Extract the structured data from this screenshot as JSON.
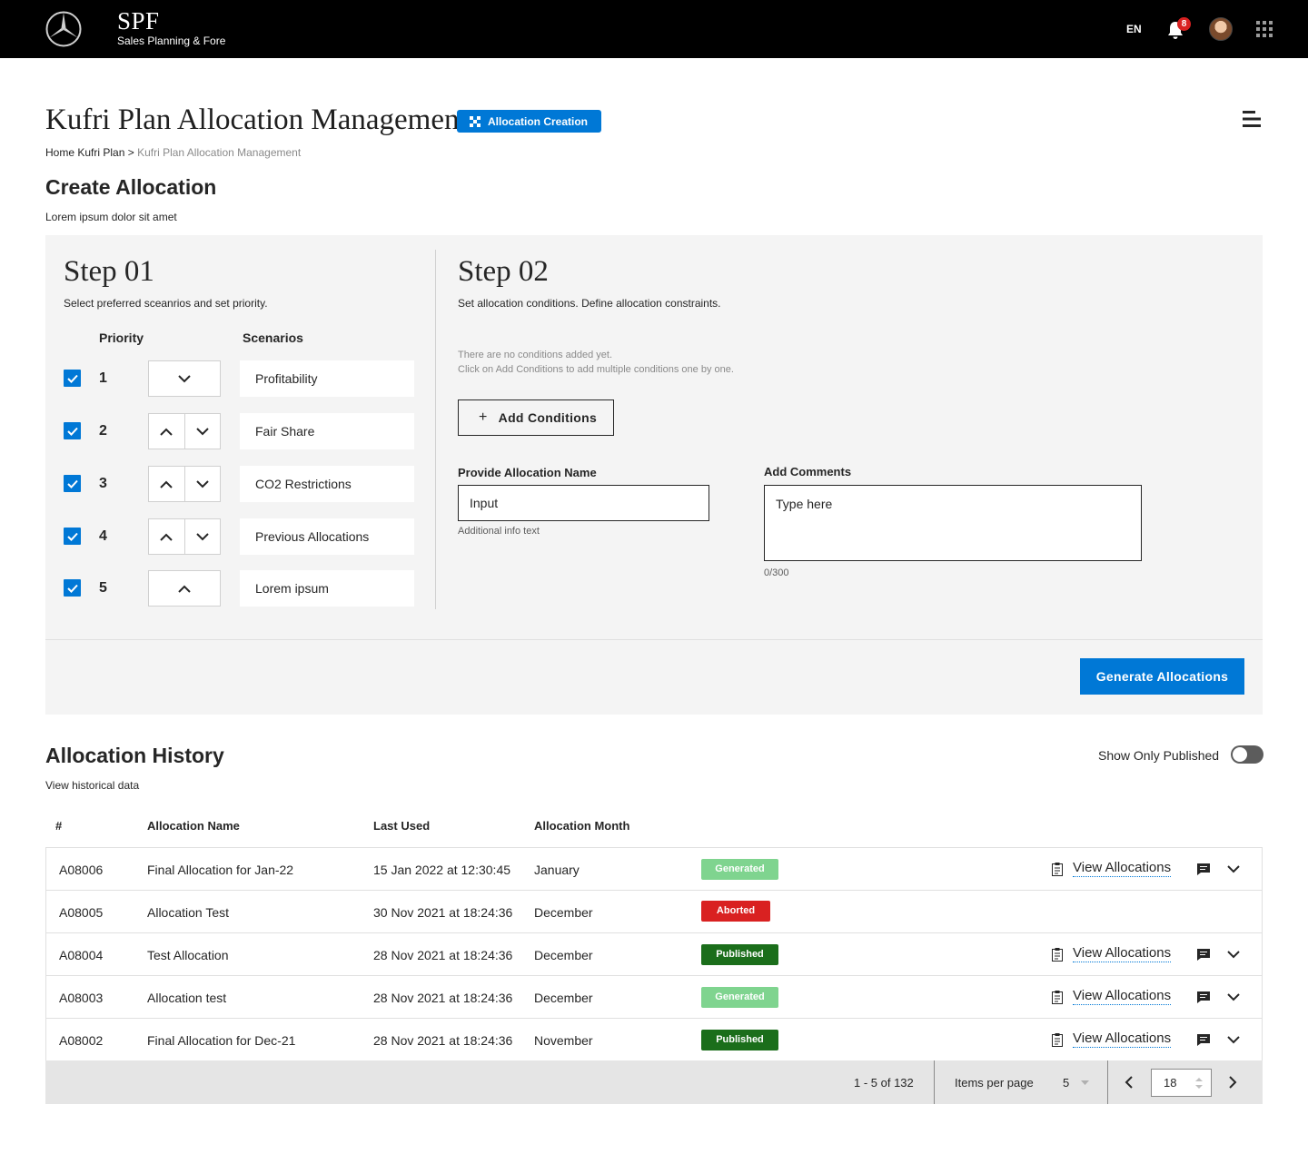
{
  "header": {
    "brand_title": "SPF",
    "brand_subtitle": "Sales Planning & Fore",
    "language": "EN",
    "notification_count": "8"
  },
  "page": {
    "title": "Kufri Plan Allocation Management",
    "chip_label": "Allocation Creation",
    "breadcrumb_links": "Home Kufri Plan",
    "breadcrumb_sep": ">",
    "breadcrumb_current": "Kufri Plan Allocation Management"
  },
  "create": {
    "title": "Create Allocation",
    "subtitle": "Lorem ipsum dolor sit amet",
    "step1": {
      "title": "Step 01",
      "desc": "Select preferred sceanrios and set priority.",
      "priority_header": "Priority",
      "scenarios_header": "Scenarios",
      "rows": [
        {
          "priority": "1",
          "scenario": "Profitability",
          "checked": true
        },
        {
          "priority": "2",
          "scenario": "Fair Share",
          "checked": true
        },
        {
          "priority": "3",
          "scenario": "CO2 Restrictions",
          "checked": true
        },
        {
          "priority": "4",
          "scenario": "Previous Allocations",
          "checked": true
        },
        {
          "priority": "5",
          "scenario": "Lorem ipsum",
          "checked": true
        }
      ]
    },
    "step2": {
      "title": "Step 02",
      "desc": "Set allocation conditions. Define allocation constraints.",
      "empty_line1": "There are no conditions added yet.",
      "empty_line2": "Click on Add Conditions to add multiple conditions one by one.",
      "add_conditions_label": "Add Conditions",
      "name_label": "Provide Allocation Name",
      "name_value": "Input",
      "name_help": "Additional info text",
      "comments_label": "Add Comments",
      "comments_placeholder": "Type here",
      "comments_counter": "0/300"
    },
    "generate_label": "Generate Allocations"
  },
  "history": {
    "title": "Allocation History",
    "subtitle": "View historical data",
    "toggle_label": "Show Only Published",
    "toggle_on": false,
    "columns": [
      "#",
      "Allocation Name",
      "Last Used",
      "Allocation Month"
    ],
    "view_label": "View Allocations",
    "rows": [
      {
        "id": "A08006",
        "name": "Final Allocation for Jan-22",
        "last_used": "15 Jan 2022 at 12:30:45",
        "month": "January",
        "status": "Generated",
        "has_actions": true
      },
      {
        "id": "A08005",
        "name": "Allocation Test",
        "last_used": "30 Nov 2021 at 18:24:36",
        "month": "December",
        "status": "Aborted",
        "has_actions": false
      },
      {
        "id": "A08004",
        "name": "Test Allocation",
        "last_used": "28 Nov 2021 at 18:24:36",
        "month": "December",
        "status": "Published",
        "has_actions": true
      },
      {
        "id": "A08003",
        "name": "Allocation test",
        "last_used": "28 Nov 2021 at 18:24:36",
        "month": "December",
        "status": "Generated",
        "has_actions": true
      },
      {
        "id": "A08002",
        "name": "Final Allocation for Dec-21",
        "last_used": "28 Nov 2021 at 18:24:36",
        "month": "November",
        "status": "Published",
        "has_actions": true
      }
    ],
    "status_colors": {
      "Generated": "#7fd48f",
      "Aborted": "#d92121",
      "Published": "#1b6e1b"
    },
    "pagination": {
      "range": "1 - 5 of 132",
      "items_per_page_label": "Items per page",
      "items_per_page": "5",
      "page": "18"
    }
  },
  "colors": {
    "accent": "#0078d6",
    "topbar": "#000000",
    "panel": "#f4f4f4"
  }
}
